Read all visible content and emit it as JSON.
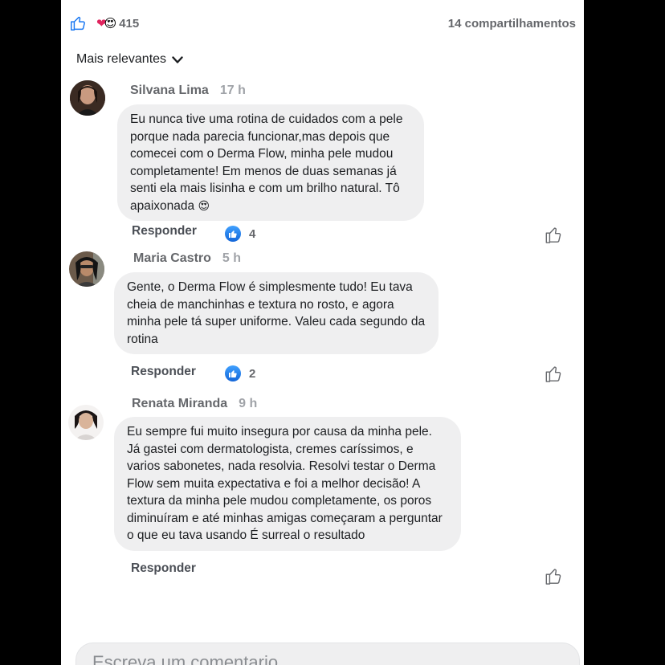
{
  "reactions": {
    "count": "415",
    "love_icon": "red-heart",
    "wow_icon": "heart-eyes-emoji",
    "like_color": "#1877f2"
  },
  "shares": "14 compartilhamentos",
  "sort": {
    "label": "Mais relevantes"
  },
  "comments": [
    {
      "author": "Silvana Lima",
      "time": "17 h",
      "text": "Eu nunca tive uma rotina de cuidados com a pele porque nada parecia funcionar,mas depois que comecei com o Derma Flow, minha pele mudou completamente! Em menos de duas semanas já senti ela mais lisinha e com um brilho natural. Tô apaixonada",
      "emoji": "😍",
      "reply_label": "Responder",
      "likes": "4"
    },
    {
      "author": "Maria Castro",
      "time": "5 h",
      "text": "Gente, o Derma Flow é simplesmente tudo! Eu tava cheia de manchinhas e textura no rosto, e agora minha pele tá super uniforme. Valeu cada segundo da rotina",
      "reply_label": "Responder",
      "likes": "2"
    },
    {
      "author": "Renata Miranda",
      "time": "9 h",
      "text": "Eu sempre fui muito insegura por causa da minha pele. Já gastei com dermatologista, cremes caríssimos, e varios sabonetes, nada resolvia. Resolvi testar o Derma Flow sem muita expectativa e foi a melhor decisão! A textura da minha pele mudou completamente, os poros diminuíram e até minhas amigas começaram a perguntar o que eu tava usando É surreal o resultado",
      "reply_label": "Responder"
    }
  ],
  "composer": {
    "placeholder": "Escreva um comentario"
  }
}
